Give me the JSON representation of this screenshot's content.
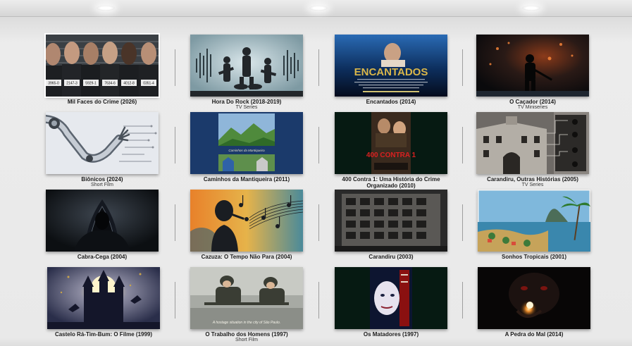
{
  "catalog": {
    "items": [
      {
        "title": "Mil Faces do Crime (2026)",
        "subtitle": "",
        "icon": "mugshot-lineup-icon",
        "tags": [
          "3965-0",
          "2147-3",
          "5929-1",
          "7634-6",
          "4012-8",
          "0351-4"
        ]
      },
      {
        "title": "Hora Do Rock (2018-2019)",
        "subtitle": "TV Series",
        "icon": "rock-band-icon"
      },
      {
        "title": "Encantados (2014)",
        "subtitle": "",
        "icon": "encantados-poster-icon",
        "poster_text": "ENCANTADOS"
      },
      {
        "title": "O Caçador (2014)",
        "subtitle": "TV Miniseries",
        "icon": "hunter-silhouette-icon"
      },
      {
        "title": "Biônicos (2024)",
        "subtitle": "Short Film",
        "icon": "bionic-arm-icon"
      },
      {
        "title": "Caminhos da Mantiqueira (2011)",
        "subtitle": "",
        "icon": "mountain-landscape-icon",
        "poster_text": "Caminhos da Mantiqueira"
      },
      {
        "title": "400 Contra 1: Uma História do Crime Organizado (2010)",
        "subtitle": "",
        "icon": "400-contra-poster-icon",
        "poster_text": "400 CONTRA 1"
      },
      {
        "title": "Carandiru, Outras Histórias (2005)",
        "subtitle": "TV Series",
        "icon": "prison-building-icon"
      },
      {
        "title": "Cabra-Cega (2004)",
        "subtitle": "",
        "icon": "hooded-figure-icon"
      },
      {
        "title": "Cazuza: O Tempo Não Para (2004)",
        "subtitle": "",
        "icon": "singer-music-notes-icon"
      },
      {
        "title": "Carandiru (2003)",
        "subtitle": "",
        "icon": "apartment-block-icon"
      },
      {
        "title": "Sonhos Tropicais (2001)",
        "subtitle": "",
        "icon": "tropical-bay-icon"
      },
      {
        "title": "Castelo Rá-Tim-Bum: O Filme (1999)",
        "subtitle": "",
        "icon": "castle-silhouette-icon"
      },
      {
        "title": "O Trabalho dos Homens (1997)",
        "subtitle": "Short Film",
        "icon": "soldiers-photo-icon",
        "poster_text": "A hostage situation in the city of São Paulo."
      },
      {
        "title": "Os Matadores (1997)",
        "subtitle": "",
        "icon": "matadores-poster-icon"
      },
      {
        "title": "A Pedra do Mal (2014)",
        "subtitle": "",
        "icon": "glowing-stone-face-icon"
      }
    ]
  }
}
